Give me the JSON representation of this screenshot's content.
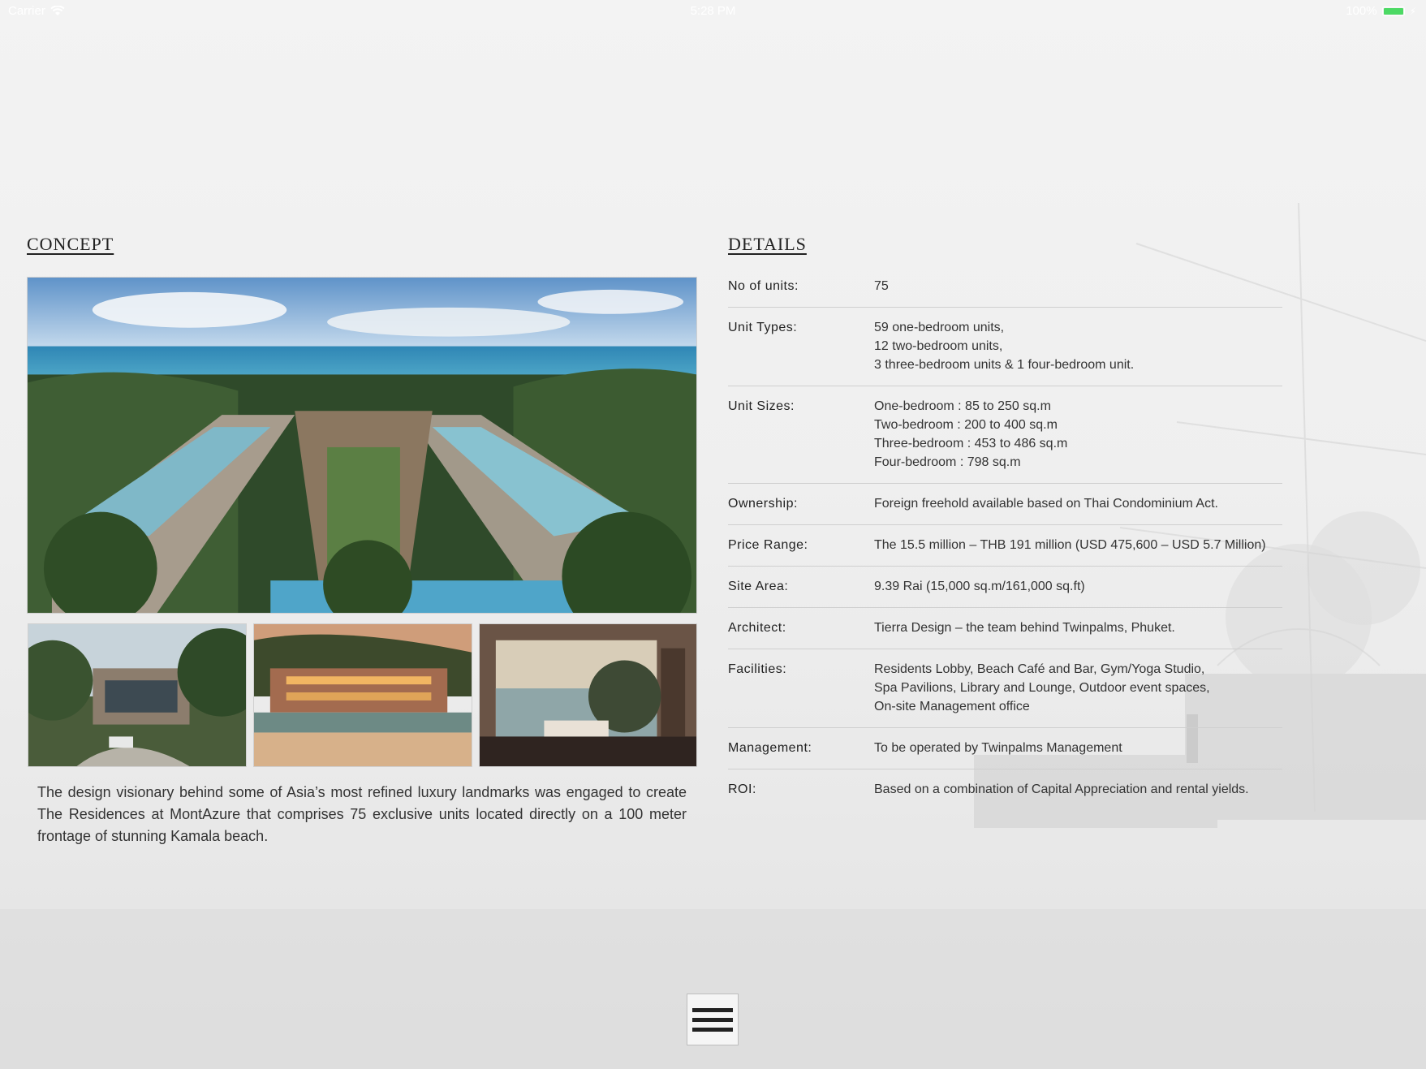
{
  "status_bar": {
    "carrier": "Carrier",
    "time": "5:28 PM",
    "battery": "100%",
    "battery_level": 1.0
  },
  "concept": {
    "heading": "CONCEPT",
    "text": "The design visionary behind some of Asia’s most refined luxury landmarks was engaged to create The Residences at MontAzure that comprises 75 exclusive units located directly on a 100 meter frontage of stunning Kamala beach."
  },
  "details": {
    "heading": "DETAILS",
    "rows": [
      {
        "label": "No of units:",
        "lines": [
          "75"
        ]
      },
      {
        "label": "Unit Types:",
        "lines": [
          "59 one-bedroom units,",
          "12 two-bedroom units,",
          "3 three-bedroom units & 1 four-bedroom unit."
        ]
      },
      {
        "label": "Unit Sizes:",
        "lines": [
          "One-bedroom : 85 to 250 sq.m",
          "Two-bedroom : 200 to 400 sq.m",
          "Three-bedroom : 453 to 486 sq.m",
          "Four-bedroom : 798 sq.m"
        ]
      },
      {
        "label": "Ownership:",
        "lines": [
          "Foreign freehold available based on Thai Condominium Act."
        ]
      },
      {
        "label": "Price Range:",
        "lines": [
          "The 15.5 million – THB 191 million (USD 475,600 – USD 5.7 Million)"
        ]
      },
      {
        "label": "Site Area:",
        "lines": [
          "9.39 Rai (15,000 sq.m/161,000 sq.ft)"
        ]
      },
      {
        "label": "Architect:",
        "lines": [
          "Tierra Design – the team behind Twinpalms, Phuket."
        ]
      },
      {
        "label": "Facilities:",
        "lines": [
          "Residents Lobby, Beach Café and Bar, Gym/Yoga Studio,",
          "Spa Pavilions, Library and Lounge, Outdoor event spaces,",
          "On-site Management office"
        ]
      },
      {
        "label": "Management:",
        "lines": [
          "To be operated by Twinpalms Management"
        ]
      },
      {
        "label": "ROI:",
        "lines": [
          "Based on a combination of Capital Appreciation and rental yields."
        ]
      }
    ]
  },
  "icons": {
    "wifi": "wifi-icon",
    "battery": "battery-icon",
    "menu": "hamburger-menu-icon"
  },
  "colors": {
    "battery_green": "#4cd964",
    "heading": "#222222",
    "divider": "#cfcfcf"
  }
}
